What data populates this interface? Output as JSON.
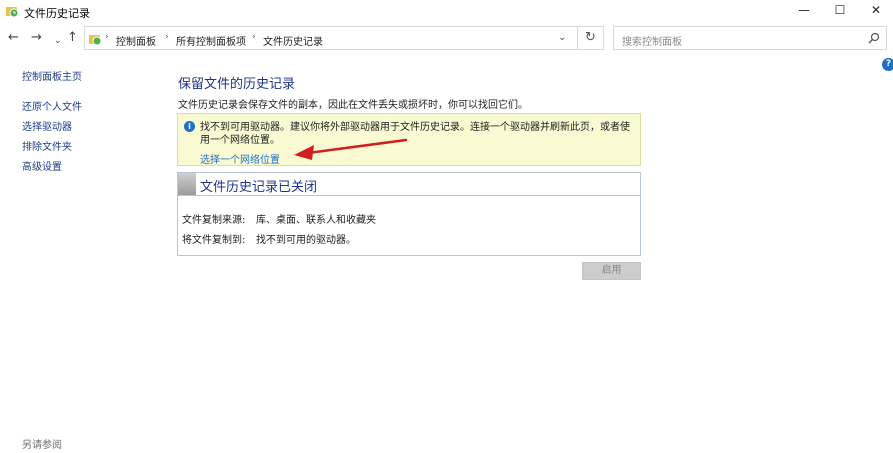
{
  "window": {
    "title": "文件历史记录",
    "minimize": "—",
    "maximize": "☐",
    "close": "✕"
  },
  "nav": {
    "back": "←",
    "forward": "→",
    "recent": "⌄",
    "up": "↑",
    "breadcrumbs": [
      "控制面板",
      "所有控制面板项",
      "文件历史记录"
    ],
    "separator": "›",
    "dropdown": "⌄",
    "refresh": "↻",
    "search_placeholder": "搜索控制面板"
  },
  "help": "?",
  "sidebar": {
    "items": [
      {
        "label": "控制面板主页"
      },
      {
        "label": "还原个人文件"
      },
      {
        "label": "选择驱动器"
      },
      {
        "label": "排除文件夹"
      },
      {
        "label": "高级设置"
      }
    ],
    "see_also": "另请参阅"
  },
  "main": {
    "heading": "保留文件的历史记录",
    "description": "文件历史记录会保存文件的副本，因此在文件丢失或损坏时，你可以找回它们。",
    "warning": {
      "icon": "i",
      "text": "找不到可用驱动器。建议你将外部驱动器用于文件历史记录。连接一个驱动器并刷新此页，或者使用一个网络位置。",
      "link": "选择一个网络位置"
    },
    "status": {
      "title": "文件历史记录已关闭",
      "rows": [
        {
          "label": "文件复制来源:",
          "value": "库、桌面、联系人和收藏夹"
        },
        {
          "label": "将文件复制到:",
          "value": "找不到可用的驱动器。"
        }
      ]
    },
    "enable_button": "启用"
  },
  "colors": {
    "heading": "#1e3287",
    "link": "#1f6fc5",
    "warning_bg": "#fafad2",
    "annotation_arrow": "#d11f1f"
  }
}
